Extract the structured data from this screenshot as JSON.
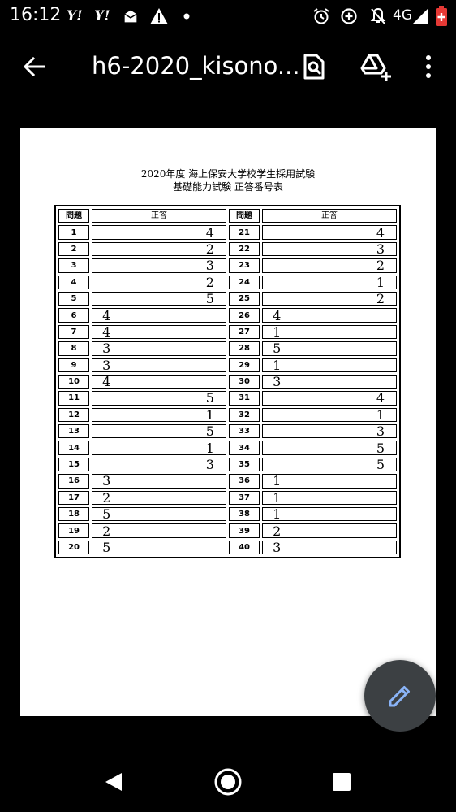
{
  "status_bar": {
    "time": "16:12",
    "notification_icons": [
      "yahoo-icon",
      "yahoo-icon",
      "mail-icon",
      "warning-icon",
      "dot-icon"
    ],
    "yahoo_label": "Y!",
    "network": "4G",
    "battery_color": "#e53935"
  },
  "app_bar": {
    "title": "h6-2020_kisono...",
    "icons": [
      "back-arrow-icon",
      "find-in-page-icon",
      "add-to-drive-icon",
      "more-vert-icon"
    ]
  },
  "document": {
    "title_line1": "2020年度 海上保安大学校学生採用試験",
    "title_line2": "基礎能力試験 正答番号表",
    "header_question": "問題",
    "header_answer": "正答",
    "rows": [
      {
        "q1": "1",
        "a1": "4",
        "a1_align": "right",
        "q2": "21",
        "a2": "4",
        "a2_align": "right"
      },
      {
        "q1": "2",
        "a1": "2",
        "a1_align": "right",
        "q2": "22",
        "a2": "3",
        "a2_align": "right"
      },
      {
        "q1": "3",
        "a1": "3",
        "a1_align": "right",
        "q2": "23",
        "a2": "2",
        "a2_align": "right"
      },
      {
        "q1": "4",
        "a1": "2",
        "a1_align": "right",
        "q2": "24",
        "a2": "1",
        "a2_align": "right"
      },
      {
        "q1": "5",
        "a1": "5",
        "a1_align": "right",
        "q2": "25",
        "a2": "2",
        "a2_align": "right"
      },
      {
        "q1": "6",
        "a1": "4",
        "a1_align": "left",
        "q2": "26",
        "a2": "4",
        "a2_align": "left"
      },
      {
        "q1": "7",
        "a1": "4",
        "a1_align": "left",
        "q2": "27",
        "a2": "1",
        "a2_align": "left"
      },
      {
        "q1": "8",
        "a1": "3",
        "a1_align": "left",
        "q2": "28",
        "a2": "5",
        "a2_align": "left"
      },
      {
        "q1": "9",
        "a1": "3",
        "a1_align": "left",
        "q2": "29",
        "a2": "1",
        "a2_align": "left"
      },
      {
        "q1": "10",
        "a1": "4",
        "a1_align": "left",
        "q2": "30",
        "a2": "3",
        "a2_align": "left"
      },
      {
        "q1": "11",
        "a1": "5",
        "a1_align": "right",
        "q2": "31",
        "a2": "4",
        "a2_align": "right"
      },
      {
        "q1": "12",
        "a1": "1",
        "a1_align": "right",
        "q2": "32",
        "a2": "1",
        "a2_align": "right"
      },
      {
        "q1": "13",
        "a1": "5",
        "a1_align": "right",
        "q2": "33",
        "a2": "3",
        "a2_align": "right"
      },
      {
        "q1": "14",
        "a1": "1",
        "a1_align": "right",
        "q2": "34",
        "a2": "5",
        "a2_align": "right"
      },
      {
        "q1": "15",
        "a1": "3",
        "a1_align": "right",
        "q2": "35",
        "a2": "5",
        "a2_align": "right"
      },
      {
        "q1": "16",
        "a1": "3",
        "a1_align": "left",
        "q2": "36",
        "a2": "1",
        "a2_align": "left"
      },
      {
        "q1": "17",
        "a1": "2",
        "a1_align": "left",
        "q2": "37",
        "a2": "1",
        "a2_align": "left"
      },
      {
        "q1": "18",
        "a1": "5",
        "a1_align": "left",
        "q2": "38",
        "a2": "1",
        "a2_align": "left"
      },
      {
        "q1": "19",
        "a1": "2",
        "a1_align": "left",
        "q2": "39",
        "a2": "2",
        "a2_align": "left"
      },
      {
        "q1": "20",
        "a1": "5",
        "a1_align": "left",
        "q2": "40",
        "a2": "3",
        "a2_align": "left"
      }
    ]
  },
  "fab": {
    "icon": "edit-pencil-icon",
    "color": "#3c4043",
    "icon_color": "#8ab4f8"
  },
  "nav_bar": {
    "icons": [
      "nav-back-icon",
      "nav-home-icon",
      "nav-recents-icon"
    ]
  }
}
